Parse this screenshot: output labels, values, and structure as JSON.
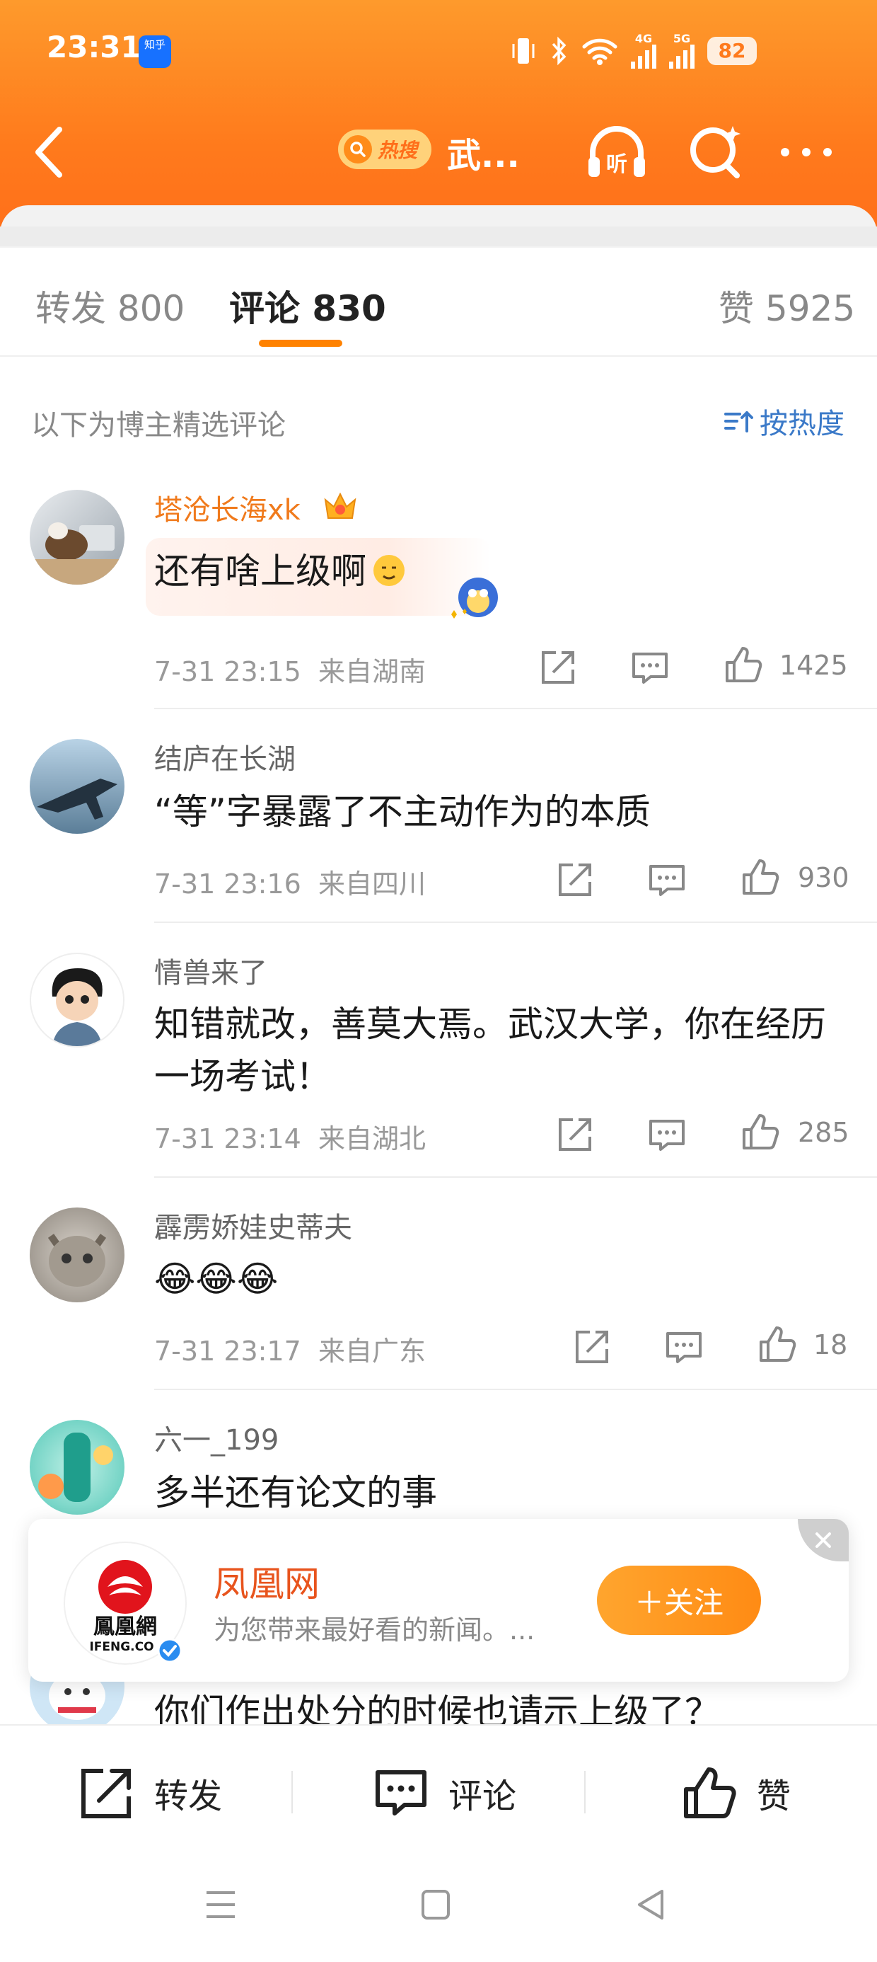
{
  "status_bar": {
    "time": "23:31",
    "app_badge": "知乎",
    "signal_labels": [
      "4G",
      "5G"
    ],
    "battery": "82"
  },
  "header": {
    "search_tag": "热搜",
    "title": "武...",
    "listen_label": "听"
  },
  "tabs": [
    {
      "label": "转发 800"
    },
    {
      "label": "评论 830"
    },
    {
      "label": "赞 5925"
    }
  ],
  "filter": {
    "note": "以下为博主精选评论",
    "sort_label": "按热度"
  },
  "comments": [
    {
      "user": "塔沧长海xk",
      "text": "还有啥上级啊",
      "time": "7-31 23:15",
      "location": "来自湖南",
      "likes": "1425"
    },
    {
      "user": "结庐在长湖",
      "text": "“等”字暴露了不主动作为的本质",
      "time": "7-31 23:16",
      "location": "来自四川",
      "likes": "930"
    },
    {
      "user": "情兽来了",
      "text": "知错就改，善莫大焉。武汉大学，你在经历一场考试！",
      "time": "7-31 23:14",
      "location": "来自湖北",
      "likes": "285"
    },
    {
      "user": "霹雳娇娃史蒂夫",
      "text": "😂😂😂",
      "time": "7-31 23:17",
      "location": "来自广东",
      "likes": "18"
    },
    {
      "user": "六一_199",
      "text": "多半还有论文的事"
    },
    {
      "text": "你们作出处分的时候也请示上级了？"
    }
  ],
  "follow_card": {
    "name": "凤凰网",
    "description": "为您带来最好看的新闻。...",
    "logo_text": "鳳凰網",
    "logo_sub": "IFENG.CO",
    "follow_label": "＋关注"
  },
  "bottom_bar": {
    "repost": "转发",
    "comment": "评论",
    "like": "赞"
  },
  "colors": {
    "header_orange": "#ff7a1c",
    "accent": "#ff8200",
    "vip_name": "#f07a1c",
    "link_blue": "#3a79c8"
  }
}
